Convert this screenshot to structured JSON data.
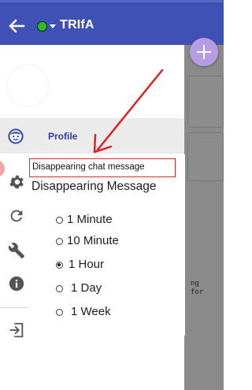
{
  "appbar": {
    "title": "TRIfA",
    "status_color": "#22c41e",
    "background": "#3f51b5",
    "back_icon": "arrow-left-icon",
    "dropdown_icon": "triangle-down-icon"
  },
  "background_chat": {
    "card_text_lines": [
      "ng",
      "for"
    ]
  },
  "fab": {
    "icon": "plus-icon",
    "color": "#b79be3"
  },
  "drawer": {
    "profile_label": "Profile",
    "profile_icon": "smiley-face-icon",
    "menu_icons": [
      "gear-icon",
      "refresh-icon",
      "wrench-icon",
      "info-icon"
    ],
    "logout_icon": "exit-icon"
  },
  "annotation": {
    "label": "Disappearing chat message",
    "color": "#d62b2b"
  },
  "dialog": {
    "title": "Disappearing Message",
    "options": [
      {
        "label": "1 Minute",
        "selected": false
      },
      {
        "label": "10 Minute",
        "selected": false
      },
      {
        "label": "1 Hour",
        "selected": true
      },
      {
        "label": "1 Day",
        "selected": false
      },
      {
        "label": "1 Week",
        "selected": false
      }
    ]
  }
}
